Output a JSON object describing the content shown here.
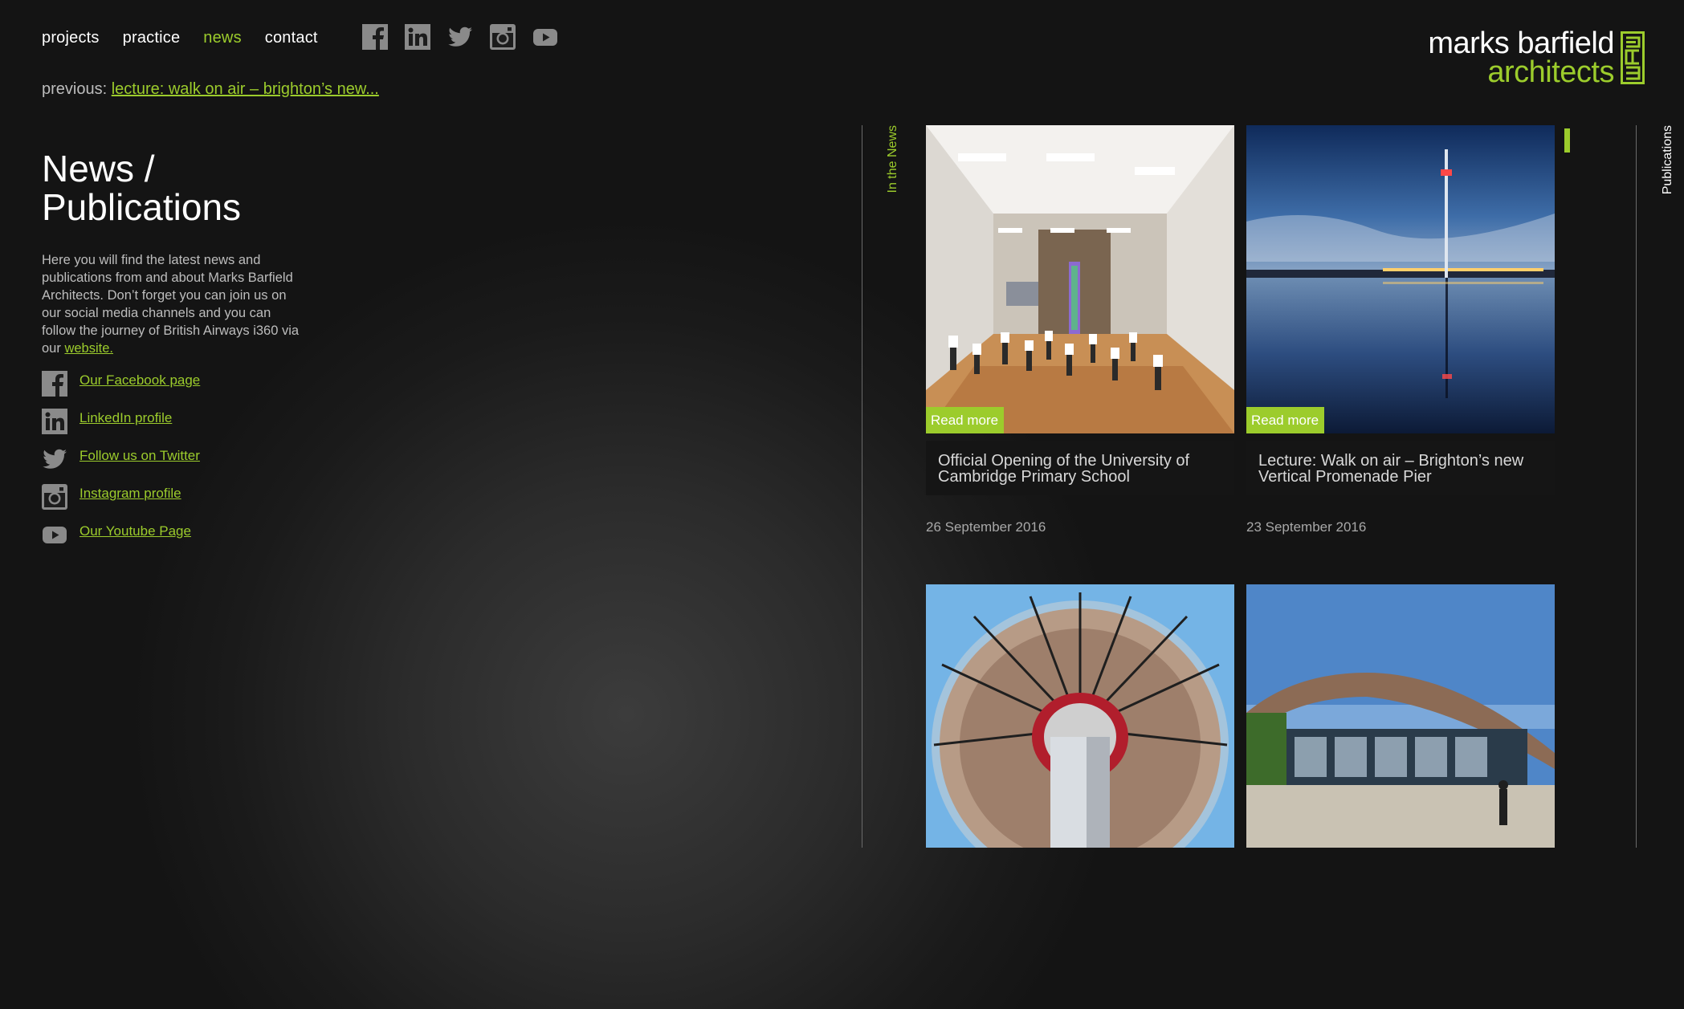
{
  "nav": {
    "items": [
      {
        "label": "projects",
        "active": false
      },
      {
        "label": "practice",
        "active": false
      },
      {
        "label": "news",
        "active": true
      },
      {
        "label": "contact",
        "active": false
      }
    ]
  },
  "social_icons_top": [
    "facebook-icon",
    "linkedin-icon",
    "twitter-icon",
    "instagram-icon",
    "youtube-icon"
  ],
  "previous": {
    "prefix": "previous:",
    "link": "lecture: walk on air – brighton’s new..."
  },
  "logo": {
    "line1": "marks barfield",
    "line2": "architects"
  },
  "page": {
    "title_line1": "News /",
    "title_line2": "Publications",
    "intro": "Here you will find the latest news and publications from and about Marks Barfield Architects. Don’t forget you can join us on our social media channels and you can follow the journey of British Airways i360 via our",
    "intro_link": "website."
  },
  "social_links": [
    {
      "icon": "facebook-icon",
      "label": "Our Facebook page"
    },
    {
      "icon": "linkedin-icon",
      "label": "LinkedIn profile"
    },
    {
      "icon": "twitter-icon",
      "label": "Follow us on Twitter"
    },
    {
      "icon": "instagram-icon",
      "label": "Instagram profile"
    },
    {
      "icon": "youtube-icon",
      "label": "Our Youtube Page"
    }
  ],
  "sections": {
    "in_the_news": "In the News",
    "publications": "Publications"
  },
  "cards": [
    {
      "read_more": "Read more",
      "title": "Official Opening of the University of Cambridge Primary School",
      "date": "26 September 2016"
    },
    {
      "read_more": "Read more",
      "title": "Lecture: Walk on air – Brighton’s new Vertical Promenade Pier",
      "date": "23 September 2016"
    },
    {
      "read_more": "",
      "title": "",
      "date": ""
    },
    {
      "read_more": "",
      "title": "",
      "date": ""
    }
  ],
  "colors": {
    "accent": "#9ccc2c",
    "background": "#1a1a1a",
    "icon_grey": "#8a8a8a"
  }
}
